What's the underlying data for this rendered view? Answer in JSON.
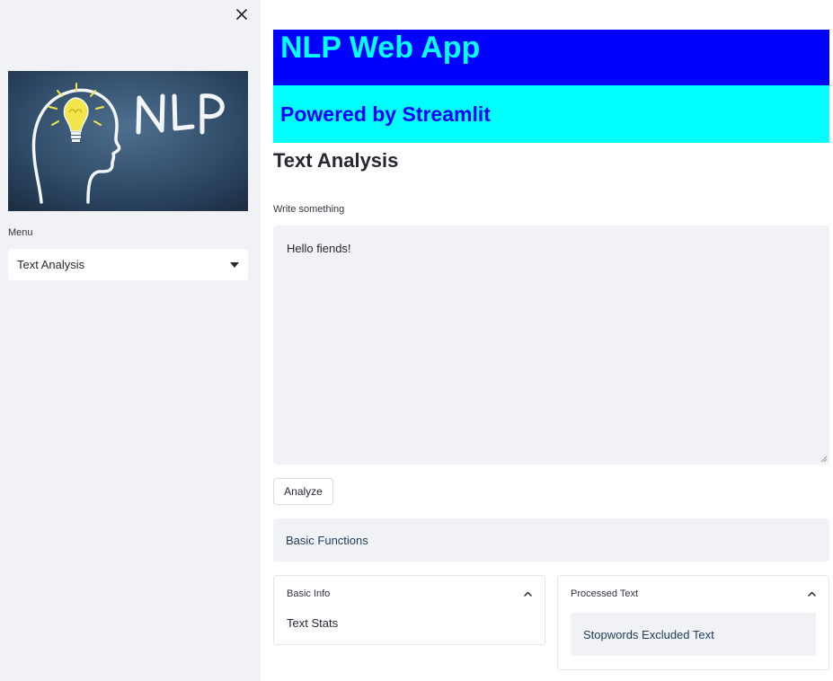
{
  "colors": {
    "sidebar_bg": "#f0f2f6",
    "banner_blue_bg": "#0000ff",
    "banner_blue_text": "#00ffff",
    "banner_cyan_bg": "#00ffff",
    "banner_cyan_text": "#0000ff"
  },
  "sidebar": {
    "close_icon": "close-icon",
    "image": {
      "lettering": "NLP",
      "icon": "head-with-lightbulb"
    },
    "menu_label": "Menu",
    "menu_selected": "Text Analysis",
    "menu_chevron_icon": "caret-down-icon"
  },
  "main": {
    "banner_title": "NLP Web App",
    "banner_subtitle": "Powered by Streamlit",
    "section_title": "Text Analysis",
    "textarea_label": "Write something",
    "textarea_value": "Hello fiends!",
    "analyze_button": "Analyze",
    "basic_functions": "Basic Functions",
    "expander_basic_info": {
      "title": "Basic Info",
      "content": "Text Stats",
      "icon": "chevron-up-icon"
    },
    "expander_processed_text": {
      "title": "Processed Text",
      "content": "Stopwords Excluded Text",
      "icon": "chevron-up-icon"
    }
  }
}
